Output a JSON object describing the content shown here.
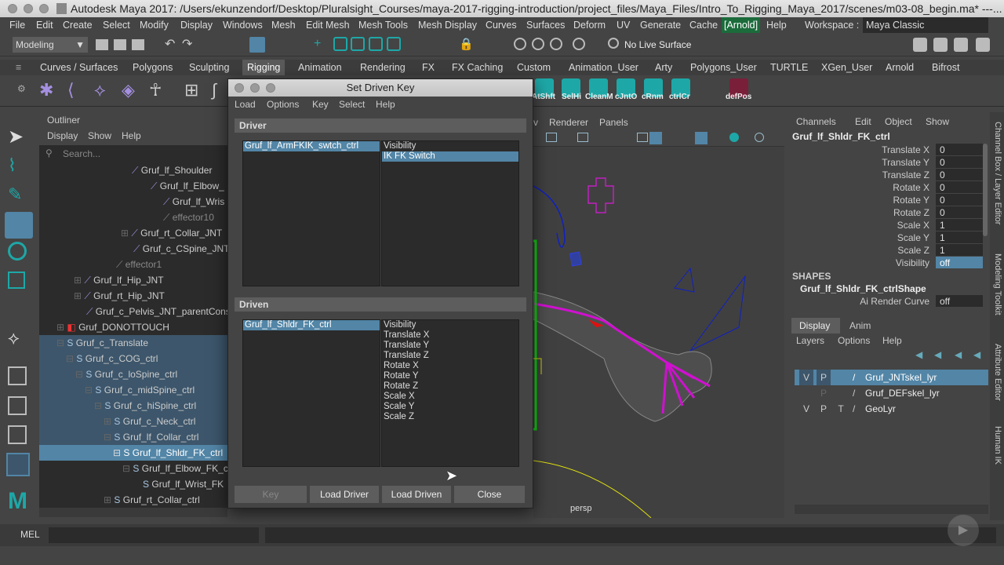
{
  "title": "Autodesk Maya 2017: /Users/ekunzendorf/Desktop/Pluralsight_Courses/maya-2017-rigging-introduction/project_files/Maya_Files/Intro_To_Rigging_Maya_2017/scenes/m03-08_begin.ma* ---...",
  "menubar": [
    "File",
    "Edit",
    "Create",
    "Select",
    "Modify",
    "Display",
    "Windows",
    "Mesh",
    "Edit Mesh",
    "Mesh Tools",
    "Mesh Display",
    "Curves",
    "Surfaces",
    "Deform",
    "UV",
    "Generate",
    "Cache",
    "[Arnold]",
    "Help"
  ],
  "workspace": {
    "label": "Workspace :",
    "value": "Maya Classic"
  },
  "status": {
    "mode": "Modeling",
    "live_surface": "No Live Surface"
  },
  "shelf_tabs": [
    "Curves / Surfaces",
    "Polygons",
    "Sculpting",
    "Rigging",
    "Animation",
    "Rendering",
    "FX",
    "FX Caching",
    "Custom",
    "Animation_User",
    "Arty",
    "Polygons_User",
    "TURTLE",
    "XGen_User",
    "Arnold",
    "Bifrost"
  ],
  "shelf_active": "Rigging",
  "shelf_buttons": [
    "AtShft",
    "SelHi",
    "CleanM",
    "cJntO",
    "cRnm",
    "ctrlCr",
    "defPos"
  ],
  "outliner": {
    "title": "Outliner",
    "menu": [
      "Display",
      "Show",
      "Help"
    ],
    "search_placeholder": "Search...",
    "rows": [
      "Gruf_lf_Shoulder",
      "Gruf_lf_Elbow_",
      "Gruf_lf_Wris",
      "effector10",
      "Gruf_rt_Collar_JNT",
      "Gruf_c_CSpine_JNT",
      "effector1",
      "Gruf_lf_Hip_JNT",
      "Gruf_rt_Hip_JNT",
      "Gruf_c_Pelvis_JNT_parentCons",
      "Gruf_DONOTTOUCH",
      "Gruf_c_Translate",
      "Gruf_c_COG_ctrl",
      "Gruf_c_loSpine_ctrl",
      "Gruf_c_midSpine_ctrl",
      "Gruf_c_hiSpine_ctrl",
      "Gruf_c_Neck_ctrl",
      "Gruf_lf_Collar_ctrl",
      "Gruf_lf_Shldr_FK_ctrl",
      "Gruf_lf_Elbow_FK_c",
      "Gruf_lf_Wrist_FK",
      "Gruf_rt_Collar_ctrl"
    ]
  },
  "viewport": {
    "menu": [
      "v",
      "Renderer",
      "Panels"
    ],
    "camera": "persp"
  },
  "dialog": {
    "title": "Set Driven Key",
    "menu": [
      "Load",
      "Options",
      "Key",
      "Select",
      "Help"
    ],
    "driver_header": "Driver",
    "driver_object": "Gruf_lf_ArmFKIK_swtch_ctrl",
    "driver_attrs": [
      "Visibility",
      "IK FK Switch"
    ],
    "driver_selected_attr": "IK FK Switch",
    "driven_header": "Driven",
    "driven_object": "Gruf_lf_Shldr_FK_ctrl",
    "driven_attrs": [
      "Visibility",
      "Translate X",
      "Translate Y",
      "Translate Z",
      "Rotate X",
      "Rotate Y",
      "Rotate Z",
      "Scale X",
      "Scale Y",
      "Scale Z"
    ],
    "buttons": {
      "key": "Key",
      "load_driver": "Load Driver",
      "load_driven": "Load Driven",
      "close": "Close"
    }
  },
  "channelbox": {
    "menu": [
      "Channels",
      "Edit",
      "Object",
      "Show"
    ],
    "object": "Gruf_lf_Shldr_FK_ctrl",
    "channels": [
      {
        "name": "Translate X",
        "value": "0"
      },
      {
        "name": "Translate Y",
        "value": "0"
      },
      {
        "name": "Translate Z",
        "value": "0"
      },
      {
        "name": "Rotate X",
        "value": "0"
      },
      {
        "name": "Rotate Y",
        "value": "0"
      },
      {
        "name": "Rotate Z",
        "value": "0"
      },
      {
        "name": "Scale X",
        "value": "1"
      },
      {
        "name": "Scale Y",
        "value": "1"
      },
      {
        "name": "Scale Z",
        "value": "1"
      },
      {
        "name": "Visibility",
        "value": "off"
      }
    ],
    "shapes_header": "SHAPES",
    "shape_name": "Gruf_lf_Shldr_FK_ctrlShape",
    "shape_attr": {
      "name": "Ai Render Curve",
      "value": "off"
    }
  },
  "layers": {
    "tabs": [
      "Display",
      "Anim"
    ],
    "menu": [
      "Layers",
      "Options",
      "Help"
    ],
    "rows": [
      {
        "v": "V",
        "p": "P",
        "t": "",
        "name": "Gruf_JNTskel_lyr"
      },
      {
        "v": "",
        "p": "P",
        "t": "",
        "name": "Gruf_DEFskel_lyr"
      },
      {
        "v": "V",
        "p": "P",
        "t": "T",
        "name": "GeoLyr"
      }
    ]
  },
  "right_tabs": [
    "Channel Box / Layer Editor",
    "Modeling Toolkit",
    "Attribute Editor",
    "Human IK"
  ],
  "cmdline": {
    "label": "MEL"
  },
  "colors": {
    "selection": "#5285a6",
    "outliner_highlight": "#3d566b",
    "accent_green": "#1ea7a7",
    "viewport_bg": "#404040"
  }
}
